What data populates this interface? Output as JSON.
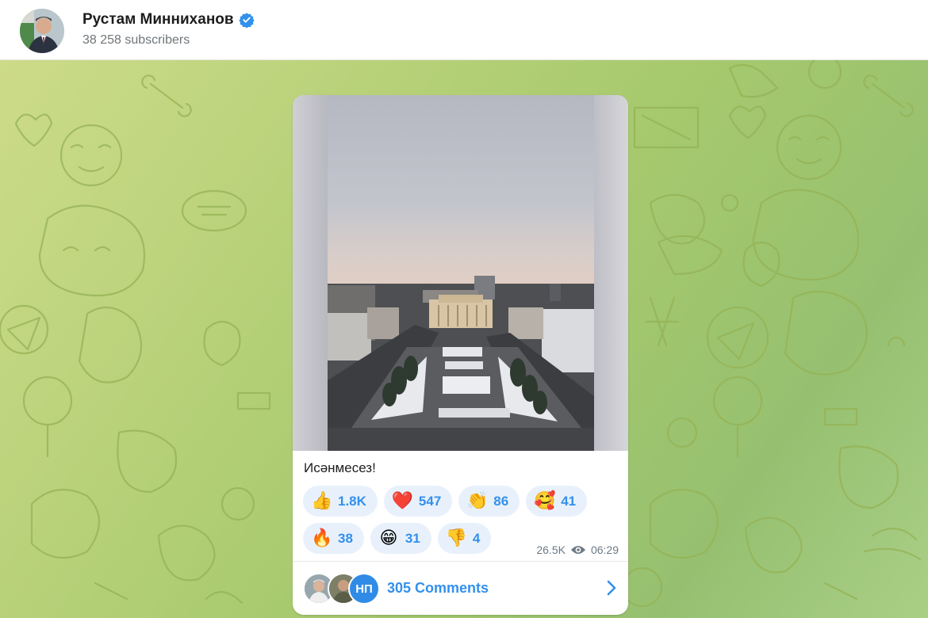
{
  "channel": {
    "title": "Рустам Минниханов",
    "subscribers": "38 258 subscribers",
    "verified": true,
    "icons": {
      "avatar": "profile-photo",
      "verified": "verified-badge-icon"
    }
  },
  "post": {
    "caption": "Исәнмесез!",
    "views": "26.5K",
    "time": "06:29",
    "reactions": [
      {
        "emoji": "👍",
        "name": "thumbs-up",
        "count": "1.8K"
      },
      {
        "emoji": "❤️",
        "name": "heart",
        "count": "547"
      },
      {
        "emoji": "👏",
        "name": "clapping",
        "count": "86"
      },
      {
        "emoji": "🥰",
        "name": "smiling-hearts",
        "count": "41"
      },
      {
        "emoji": "🔥",
        "name": "fire",
        "count": "38"
      },
      {
        "emoji": "😁",
        "name": "grinning",
        "count": "31"
      },
      {
        "emoji": "👎",
        "name": "thumbs-down",
        "count": "4"
      }
    ],
    "comments": {
      "label": "305 Comments",
      "avatar3_text": "НП"
    }
  },
  "colors": {
    "accent": "#3390ec",
    "reaction_bg": "#e8f1fb",
    "header_bg": "#ffffff",
    "wallpaper_doodle": "#8fae4e"
  }
}
